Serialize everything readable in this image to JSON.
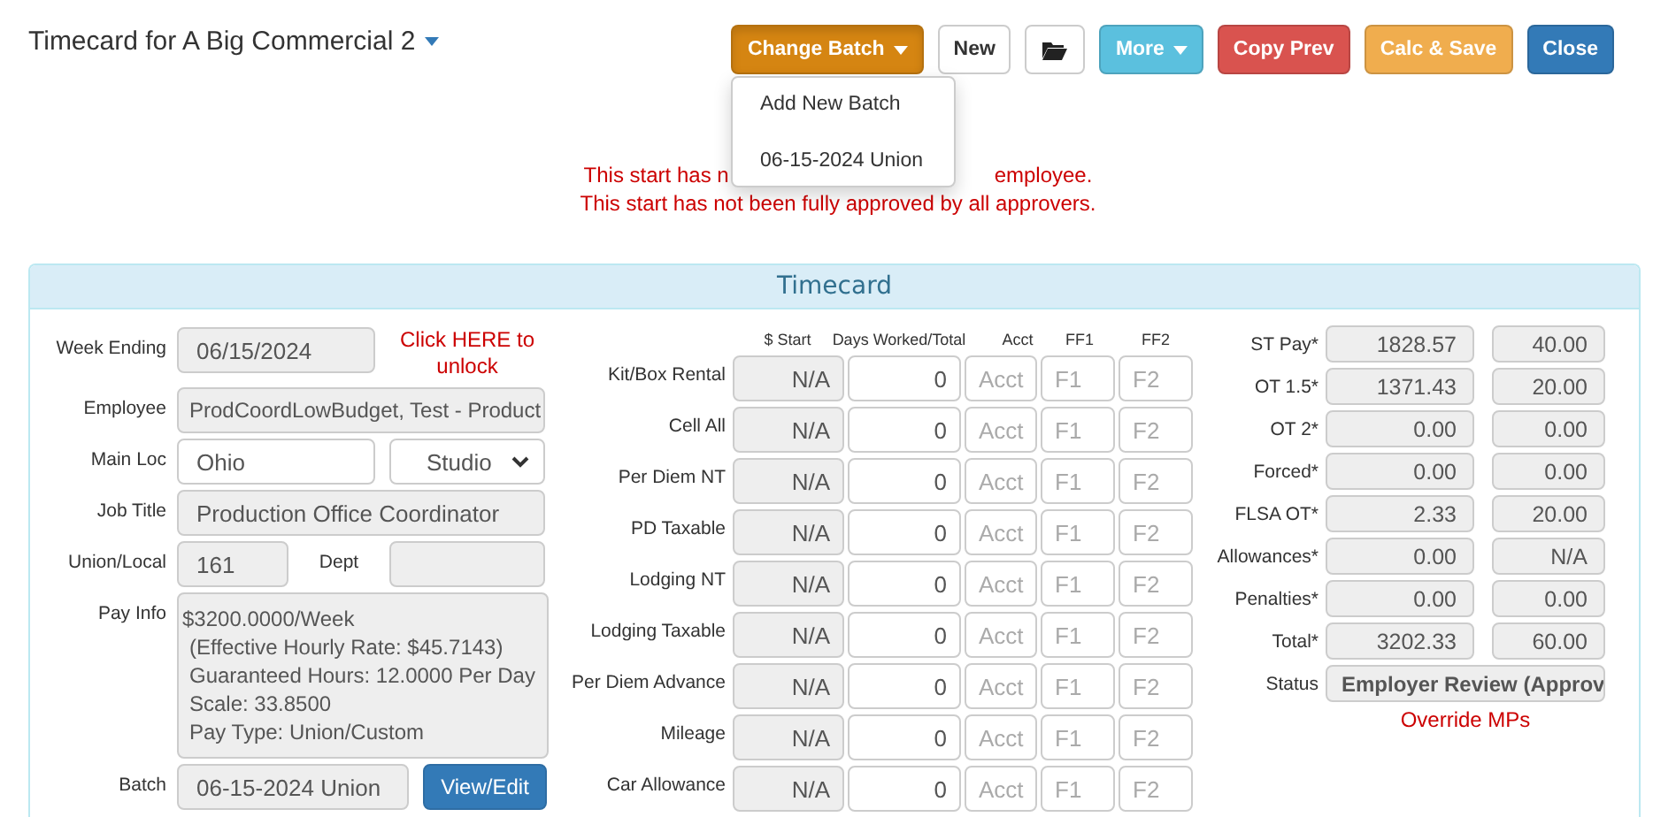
{
  "title": "Timecard for A Big Commercial 2",
  "toolbar": [
    {
      "kind": "menu",
      "label": "Change Batch",
      "color": "#d58512",
      "menu_open": true
    },
    {
      "kind": "text",
      "label": "New",
      "color": "#ffffff"
    },
    {
      "kind": "folder",
      "color": "#ffffff"
    },
    {
      "kind": "menu",
      "label": "More",
      "color": "#5bc0de",
      "menu_open": false
    },
    {
      "kind": "text",
      "label": "Copy Prev",
      "color": "#d9534f"
    },
    {
      "kind": "text",
      "label": "Calc & Save",
      "color": "#f0ad4e"
    },
    {
      "kind": "text",
      "label": "Close",
      "color": "#337ab7"
    }
  ],
  "batch_menu": [
    "Add New Batch",
    "06-15-2024 Union"
  ],
  "messages": [
    {
      "before_menu": "This start has n",
      "after_menu": "employee."
    },
    {
      "text": "This start has not been fully approved by all approvers."
    }
  ],
  "panel": {
    "title": "Timecard",
    "details": {
      "week_ending": {
        "label": "Week Ending",
        "value": "06/15/2024",
        "unlock_link": "Click HERE to unlock"
      },
      "employee": {
        "label": "Employee",
        "value": "ProdCoordLowBudget, Test - Product"
      },
      "main_loc": {
        "label": "Main Loc",
        "value": "Ohio",
        "select": "Studio"
      },
      "job_title": {
        "label": "Job Title",
        "value": "Production Office Coordinator"
      },
      "union_local": {
        "label": "Union/Local",
        "value": "161",
        "dept_label": "Dept"
      },
      "pay_info": {
        "label": "Pay Info",
        "lines": [
          "$3200.0000/Week",
          "(Effective Hourly Rate: $45.7143)",
          "Guaranteed Hours: 12.0000 Per Day",
          "Scale: 33.8500",
          "Pay Type: Union/Custom"
        ]
      },
      "batch": {
        "label": "Batch",
        "value": "06-15-2024 Union",
        "button": "View/Edit"
      }
    },
    "allowances": {
      "columns": [
        "$ Start",
        "Days Worked/Total",
        "Acct",
        "FF1",
        "FF2"
      ],
      "rows": [
        {
          "label": "Kit/Box Rental",
          "start": "N/A",
          "days": "0",
          "acct": "Acct",
          "ff1": "F1",
          "ff2": "F2"
        },
        {
          "label": "Cell All",
          "start": "N/A",
          "days": "0",
          "acct": "Acct",
          "ff1": "F1",
          "ff2": "F2"
        },
        {
          "label": "Per Diem NT",
          "start": "N/A",
          "days": "0",
          "acct": "Acct",
          "ff1": "F1",
          "ff2": "F2"
        },
        {
          "label": "PD Taxable",
          "start": "N/A",
          "days": "0",
          "acct": "Acct",
          "ff1": "F1",
          "ff2": "F2"
        },
        {
          "label": "Lodging NT",
          "start": "N/A",
          "days": "0",
          "acct": "Acct",
          "ff1": "F1",
          "ff2": "F2"
        },
        {
          "label": "Lodging Taxable",
          "start": "N/A",
          "days": "0",
          "acct": "Acct",
          "ff1": "F1",
          "ff2": "F2"
        },
        {
          "label": "Per Diem Advance",
          "start": "N/A",
          "days": "0",
          "acct": "Acct",
          "ff1": "F1",
          "ff2": "F2"
        },
        {
          "label": "Mileage",
          "start": "N/A",
          "days": "0",
          "acct": "Acct",
          "ff1": "F1",
          "ff2": "F2"
        },
        {
          "label": "Car Allowance",
          "start": "N/A",
          "days": "0",
          "acct": "Acct",
          "ff1": "F1",
          "ff2": "F2"
        }
      ]
    },
    "totals": {
      "rows": [
        {
          "label": "ST Pay*",
          "amount": "1828.57",
          "hours": "40.00"
        },
        {
          "label": "OT 1.5*",
          "amount": "1371.43",
          "hours": "20.00"
        },
        {
          "label": "OT 2*",
          "amount": "0.00",
          "hours": "0.00"
        },
        {
          "label": "Forced*",
          "amount": "0.00",
          "hours": "0.00"
        },
        {
          "label": "FLSA OT*",
          "amount": "2.33",
          "hours": "20.00"
        },
        {
          "label": "Allowances*",
          "amount": "0.00",
          "hours": "N/A"
        },
        {
          "label": "Penalties*",
          "amount": "0.00",
          "hours": "0.00"
        },
        {
          "label": "Total*",
          "amount": "3202.33",
          "hours": "60.00"
        }
      ],
      "status": {
        "label": "Status",
        "value": "Employer Review (Approv"
      },
      "override_link": "Override MPs"
    }
  }
}
